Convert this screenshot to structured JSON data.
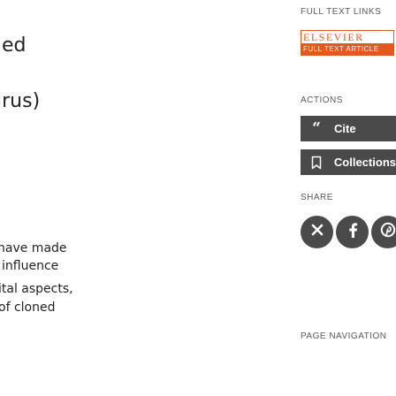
{
  "article_fragments": {
    "title_lines": [
      "ed",
      "irus)"
    ],
    "body_lines": [
      "have made",
      "influence",
      "ital aspects,",
      "of cloned"
    ]
  },
  "sidebar": {
    "full_text_links": {
      "heading": "FULL TEXT LINKS",
      "publisher_badge": {
        "brand": "ELSEVIER",
        "label": "FULL TEXT ARTICLE",
        "brand_color": "#e25a1b"
      }
    },
    "actions": {
      "heading": "ACTIONS",
      "cite_label": "Cite",
      "collections_label": "Collections",
      "cite_icon": "quote-icon",
      "collections_icon": "bookmark-icon",
      "button_color": "#4a4a4a"
    },
    "share": {
      "heading": "SHARE",
      "items": [
        "email-icon",
        "facebook-icon",
        "pinterest-icon"
      ]
    },
    "page_navigation": {
      "heading": "PAGE NAVIGATION"
    }
  }
}
